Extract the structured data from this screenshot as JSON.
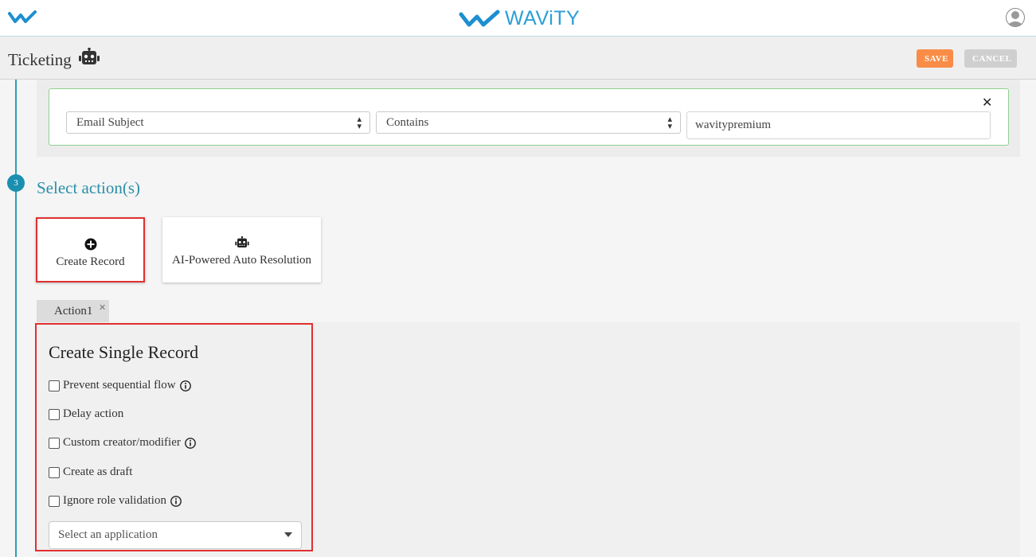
{
  "header": {
    "brand": "WAViTY"
  },
  "subheader": {
    "title": "Ticketing",
    "save_label": "SAVE",
    "cancel_label": "CANCEL"
  },
  "condition": {
    "field_value": "Email Subject",
    "operator_value": "Contains",
    "text_value": "wavitypremium"
  },
  "step": {
    "number": "3",
    "title": "Select action(s)"
  },
  "actions": {
    "create_record": "Create Record",
    "ai_resolution": "AI-Powered Auto Resolution"
  },
  "tabs": [
    {
      "label": "Action1"
    }
  ],
  "panel": {
    "title": "Create Single Record",
    "options": [
      {
        "label": "Prevent sequential flow",
        "info": true
      },
      {
        "label": "Delay action",
        "info": false
      },
      {
        "label": "Custom creator/modifier",
        "info": true
      },
      {
        "label": "Create as draft",
        "info": false
      },
      {
        "label": "Ignore role validation",
        "info": true
      }
    ],
    "app_select_placeholder": "Select an application"
  },
  "colors": {
    "accent": "#2a8fa8",
    "save": "#f98c47",
    "cancel": "#cfcfcf",
    "highlight": "#e03030",
    "brand": "#2b9fd6"
  },
  "icons": [
    "wavity-logo-icon",
    "robot-icon",
    "user-avatar-icon",
    "close-icon",
    "sort-arrows-icon",
    "plus-circle-icon",
    "info-icon",
    "caret-down-icon"
  ]
}
